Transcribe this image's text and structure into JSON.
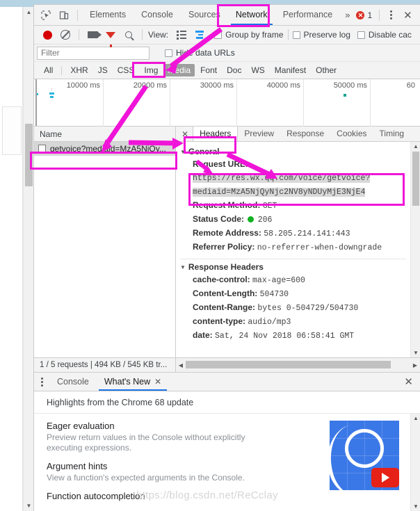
{
  "devtools": {
    "tabs": [
      {
        "label": "Elements",
        "active": false
      },
      {
        "label": "Console",
        "active": false
      },
      {
        "label": "Sources",
        "active": false
      },
      {
        "label": "Network",
        "active": true
      },
      {
        "label": "Performance",
        "active": false
      }
    ],
    "more_label": "»",
    "error_count": "1",
    "close_label": "✕"
  },
  "network_toolbar": {
    "view_label": "View:",
    "group_by_frame": "Group by frame",
    "preserve_log": "Preserve log",
    "disable_cache": "Disable cac",
    "icons": [
      "record-icon",
      "clear-icon",
      "capture-screenshots-icon",
      "filter-icon",
      "search-icon",
      "list-view-icon",
      "waterfall-view-icon"
    ]
  },
  "filter_row": {
    "placeholder": "Filter",
    "value": "",
    "hide_data_urls": "Hide data URLs"
  },
  "type_filters": [
    {
      "label": "All",
      "selected": false
    },
    {
      "label": "XHR",
      "selected": false
    },
    {
      "label": "JS",
      "selected": false
    },
    {
      "label": "CSS",
      "selected": false
    },
    {
      "label": "Img",
      "selected": false
    },
    {
      "label": "Media",
      "selected": true
    },
    {
      "label": "Font",
      "selected": false
    },
    {
      "label": "Doc",
      "selected": false
    },
    {
      "label": "WS",
      "selected": false
    },
    {
      "label": "Manifest",
      "selected": false
    },
    {
      "label": "Other",
      "selected": false
    }
  ],
  "overview": {
    "ticks": [
      "10000 ms",
      "20000 ms",
      "30000 ms",
      "40000 ms",
      "50000 ms",
      "60"
    ]
  },
  "request_list": {
    "column_header": "Name",
    "rows": [
      {
        "name": "getvoice?mediaid=MzA5NjQy...",
        "selected": true
      }
    ]
  },
  "details": {
    "tabs": [
      {
        "label": "Headers",
        "active": true
      },
      {
        "label": "Preview",
        "active": false
      },
      {
        "label": "Response",
        "active": false
      },
      {
        "label": "Cookies",
        "active": false
      },
      {
        "label": "Timing",
        "active": false
      }
    ],
    "close_label": "✕",
    "general": {
      "title": "General",
      "request_url_key": "Request URL:",
      "request_url_value": "https://res.wx.qq.com/voice/getvoice?mediaid=MzA5NjQyNjc2NV8yNDUyMjE3NjE4",
      "request_method_key": "Request Method:",
      "request_method_value": "GET",
      "status_code_key": "Status Code:",
      "status_code_value": "206",
      "remote_address_key": "Remote Address:",
      "remote_address_value": "58.205.214.141:443",
      "referrer_policy_key": "Referrer Policy:",
      "referrer_policy_value": "no-referrer-when-downgrade"
    },
    "response_headers": {
      "title": "Response Headers",
      "rows": [
        {
          "key": "cache-control:",
          "value": "max-age=600"
        },
        {
          "key": "Content-Length:",
          "value": "504730"
        },
        {
          "key": "Content-Range:",
          "value": "bytes 0-504729/504730"
        },
        {
          "key": "content-type:",
          "value": "audio/mp3"
        },
        {
          "key": "date:",
          "value": "Sat, 24 Nov 2018 06:58:41 GMT"
        }
      ]
    }
  },
  "status_bar": {
    "text": "1 / 5 requests  |  494 KB / 545 KB tr..."
  },
  "drawer": {
    "tabs": [
      {
        "label": "Console",
        "active": false,
        "closable": false
      },
      {
        "label": "What's New",
        "active": true,
        "closable": true
      }
    ],
    "close_label": "✕",
    "heading": "Highlights from the Chrome 68 update",
    "items": [
      {
        "title": "Eager evaluation",
        "desc": "Preview return values in the Console without explicitly executing expressions."
      },
      {
        "title": "Argument hints",
        "desc": "View a function's expected arguments in the Console."
      },
      {
        "title": "Function autocompletion",
        "desc": ""
      }
    ]
  },
  "watermark": "https://blog.csdn.net/ReCclay",
  "colors": {
    "accent": "#1a73e8",
    "annotation": "#f014d8",
    "status_ok": "#12b022",
    "error": "#d93025",
    "record": "#d60000"
  }
}
